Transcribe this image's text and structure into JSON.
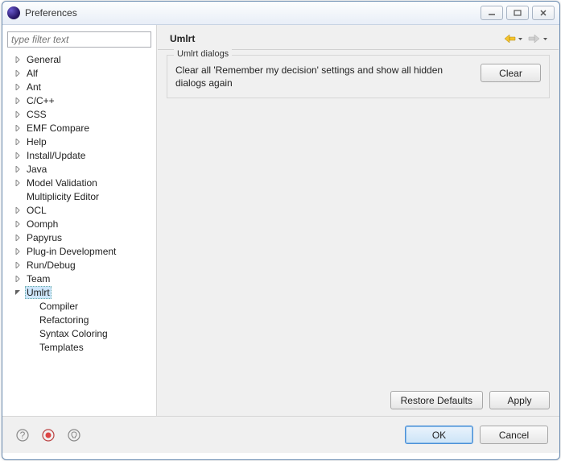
{
  "window": {
    "title": "Preferences"
  },
  "sidebar": {
    "filter_placeholder": "type filter text",
    "items": [
      {
        "label": "General",
        "expandable": true
      },
      {
        "label": "Alf",
        "expandable": true
      },
      {
        "label": "Ant",
        "expandable": true
      },
      {
        "label": "C/C++",
        "expandable": true
      },
      {
        "label": "CSS",
        "expandable": true
      },
      {
        "label": "EMF Compare",
        "expandable": true
      },
      {
        "label": "Help",
        "expandable": true
      },
      {
        "label": "Install/Update",
        "expandable": true
      },
      {
        "label": "Java",
        "expandable": true
      },
      {
        "label": "Model Validation",
        "expandable": true
      },
      {
        "label": "Multiplicity Editor",
        "expandable": false
      },
      {
        "label": "OCL",
        "expandable": true
      },
      {
        "label": "Oomph",
        "expandable": true
      },
      {
        "label": "Papyrus",
        "expandable": true
      },
      {
        "label": "Plug-in Development",
        "expandable": true
      },
      {
        "label": "Run/Debug",
        "expandable": true
      },
      {
        "label": "Team",
        "expandable": true
      },
      {
        "label": "Umlrt",
        "expandable": true,
        "expanded": true,
        "selected": true,
        "children": [
          {
            "label": "Compiler"
          },
          {
            "label": "Refactoring"
          },
          {
            "label": "Syntax Coloring"
          },
          {
            "label": "Templates"
          }
        ]
      }
    ]
  },
  "main": {
    "title": "Umlrt",
    "group_title": "Umlrt dialogs",
    "group_text": "Clear all 'Remember my decision' settings and show all hidden dialogs again",
    "clear_label": "Clear",
    "restore_label": "Restore Defaults",
    "apply_label": "Apply"
  },
  "footer": {
    "ok_label": "OK",
    "cancel_label": "Cancel"
  }
}
